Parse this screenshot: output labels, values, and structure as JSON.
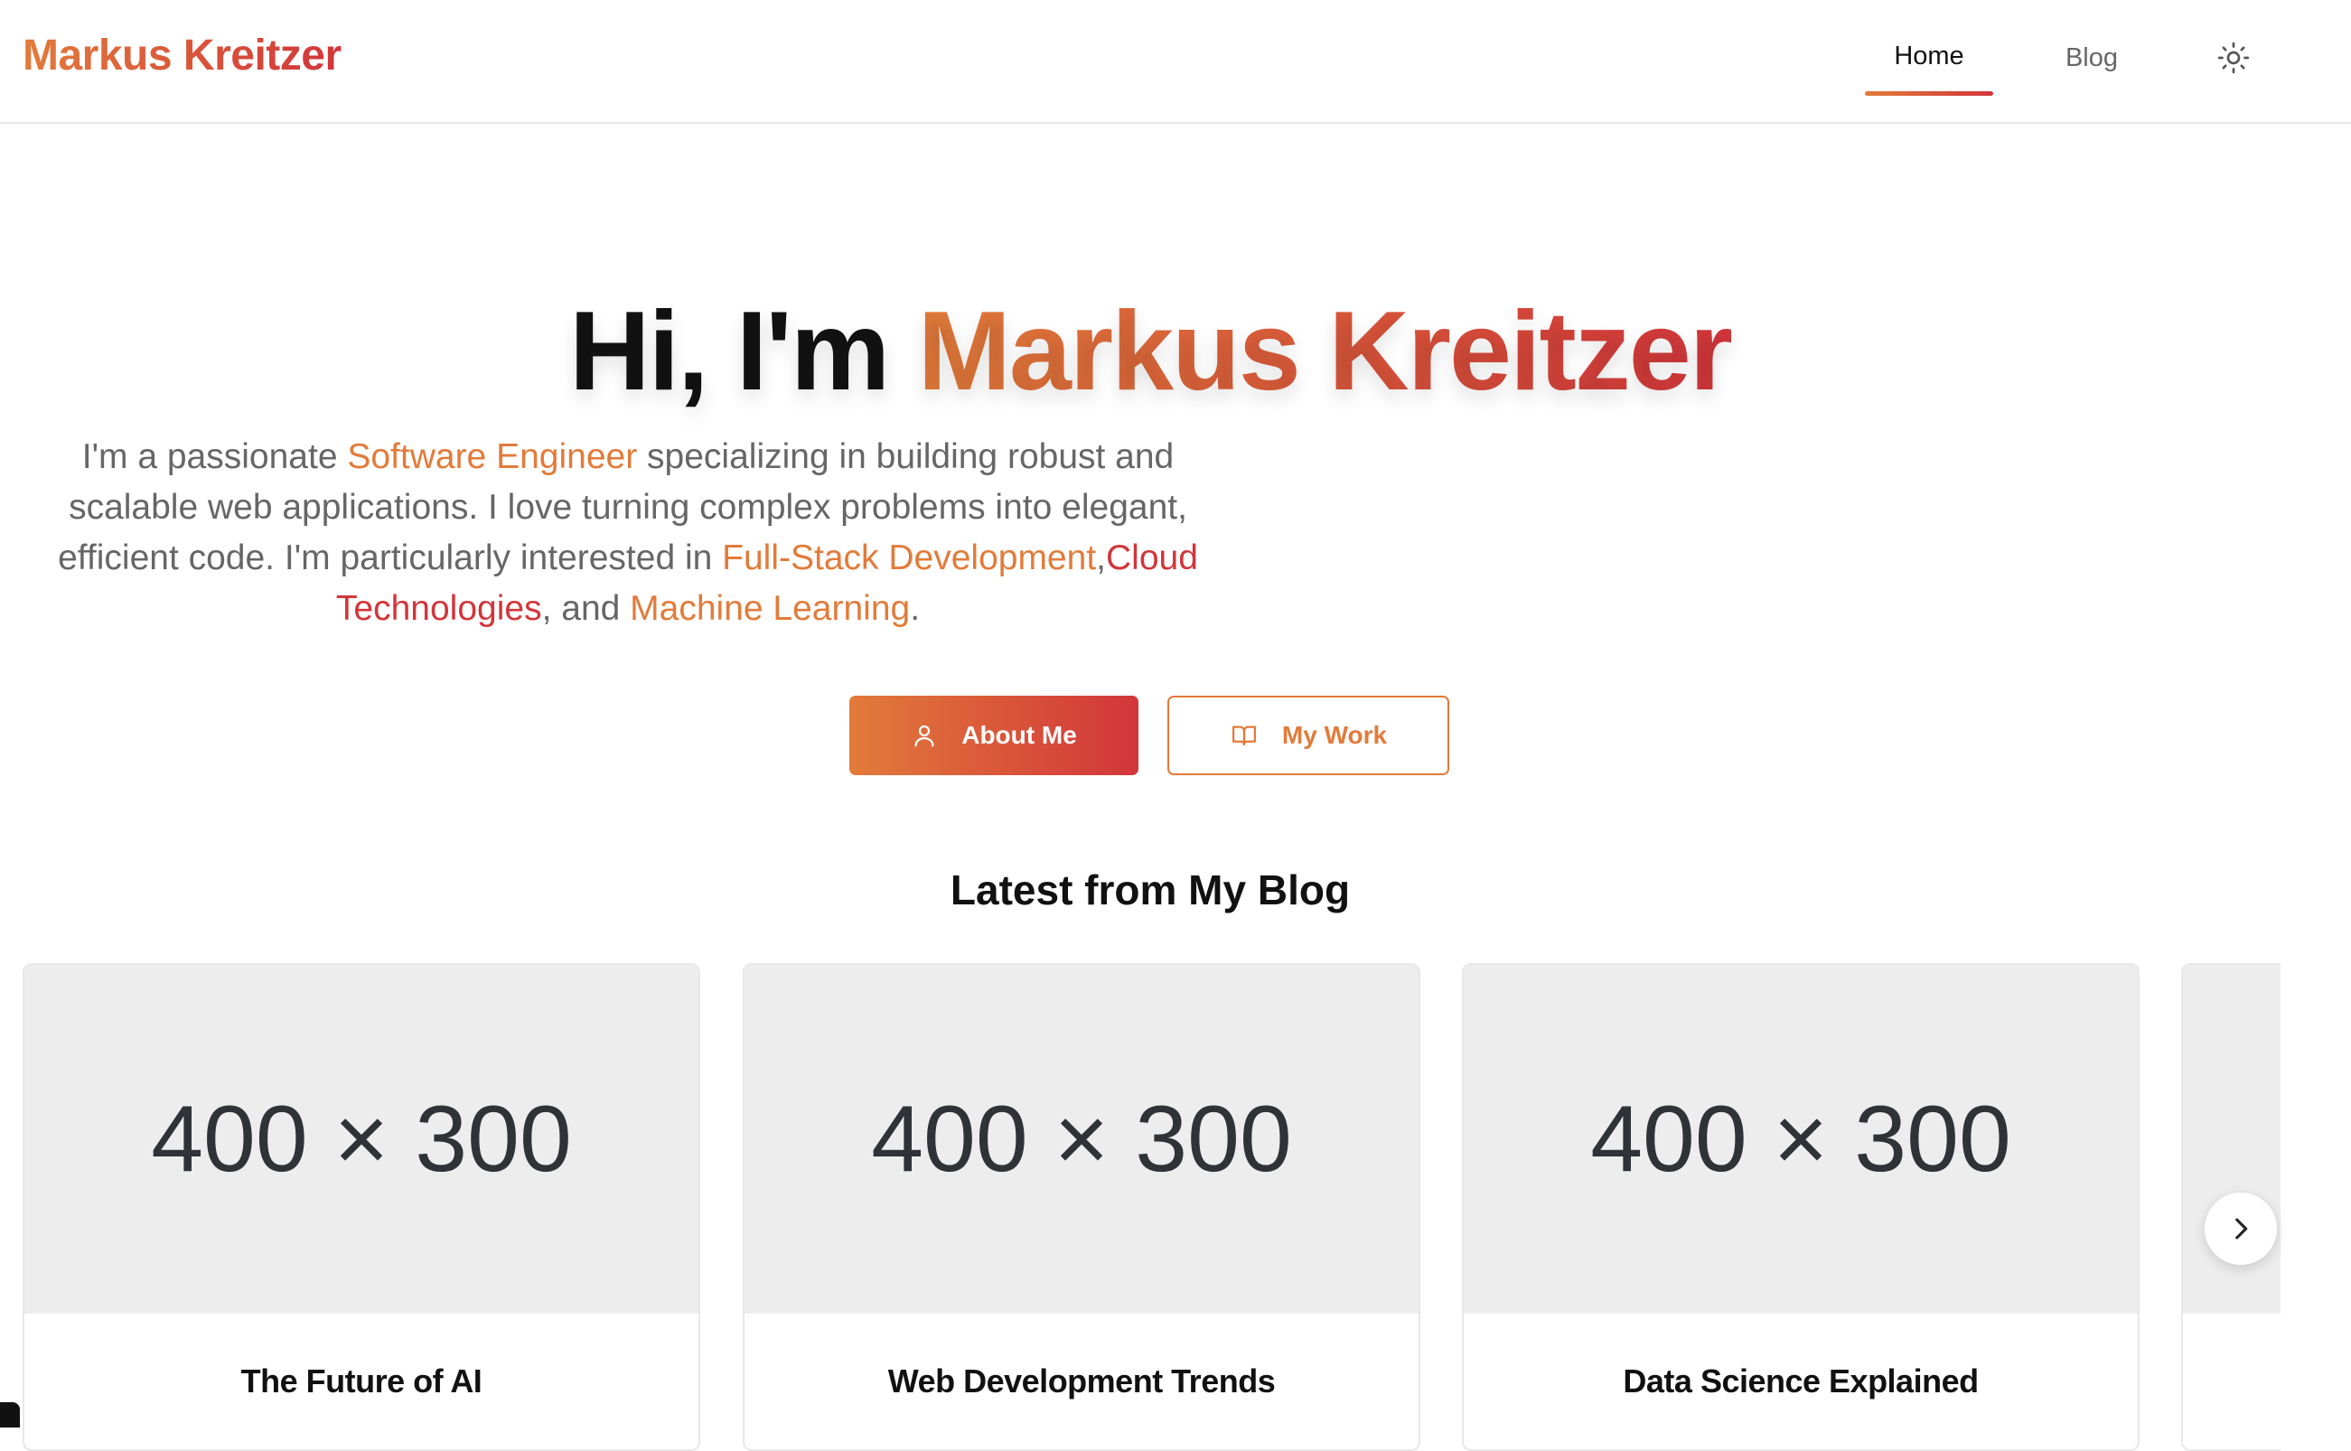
{
  "header": {
    "brand": "Markus Kreitzer",
    "nav": [
      {
        "label": "Home",
        "active": true
      },
      {
        "label": "Blog",
        "active": false
      }
    ],
    "theme_toggle_icon": "sun-icon"
  },
  "hero": {
    "title_prefix": "Hi, I'm",
    "title_name": "Markus Kreitzer",
    "desc_1": "I'm a passionate ",
    "desc_hl_1": "Software Engineer",
    "desc_2": " specializing in building robust and scalable web applications. I love turning complex problems into elegant, efficient code. I'm particularly interested in ",
    "desc_hl_2": "Full-Stack Development",
    "desc_3": ",",
    "desc_hl_3": "Cloud Technologies",
    "desc_4": ", and ",
    "desc_hl_4": "Machine Learning",
    "desc_5": ".",
    "buttons": {
      "about": {
        "label": "About Me",
        "icon": "user-icon"
      },
      "work": {
        "label": "My Work",
        "icon": "book-open-icon"
      }
    }
  },
  "blog": {
    "section_title": "Latest from My Blog",
    "cards": [
      {
        "image_placeholder": "400 × 300",
        "title": "The Future of AI"
      },
      {
        "image_placeholder": "400 × 300",
        "title": "Web Development Trends"
      },
      {
        "image_placeholder": "400 × 300",
        "title": "Data Science Explained"
      }
    ],
    "next_icon": "chevron-right-icon"
  },
  "colors": {
    "accent_start": "#e27b3a",
    "accent_end": "#d2353a"
  }
}
